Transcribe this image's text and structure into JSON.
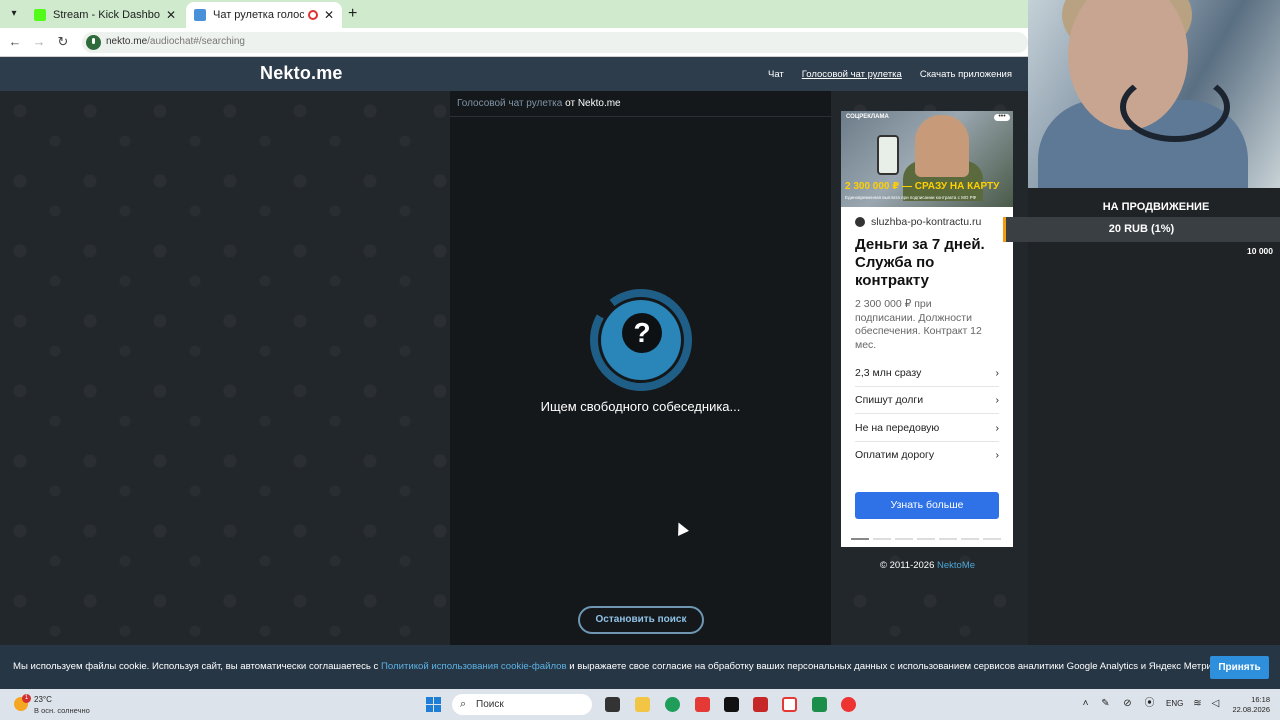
{
  "browser": {
    "tabs": [
      {
        "title": "Stream - Kick Dashboard",
        "favicon_color": "#53fc18"
      },
      {
        "title": "Чат рулетка голосовая — ",
        "favicon_color": "#4a90d9",
        "active": true
      }
    ],
    "new_tab_label": "+",
    "url_host": "nekto.me",
    "url_path": "/audiochat#/searching"
  },
  "site": {
    "logo": "Nekto.me",
    "nav": [
      "Чат",
      "Голосовой чат рулетка",
      "Скачать приложения"
    ],
    "chat_header_link": "Голосовой чат рулетка",
    "chat_header_suffix": "от Nekto.me",
    "search_icon_glyph": "?",
    "search_status": "Ищем свободного собеседника...",
    "stop_button": "Остановить поиск",
    "copyright_prefix": "© 2011-2026",
    "copyright_link": "NektoMe"
  },
  "ad": {
    "label": "СОЦРЕКЛАМА",
    "more_glyph": "•••",
    "banner": "2 300 000 ₽ — СРАЗУ НА КАРТУ",
    "banner_sub": "Единовременная выплата при подписании контракта с МО РФ",
    "domain": "sluzhba-po-kontractu.ru",
    "title": "Деньги за 7 дней. Служба по контракту",
    "description": "2 300 000 ₽ при подписании. Должности обеспечения. Контракт 12 мес.",
    "links": [
      "2,3 млн сразу",
      "Спишут долги",
      "Не на передовую",
      "Оплатим дорогу"
    ],
    "chevron": "›",
    "cta": "Узнать больше"
  },
  "stream_overlay": {
    "promo_title": "НА ПРОДВИЖЕНИЕ",
    "promo_amount": "20 RUB (1%)",
    "promo_goal": "10 000",
    "accent_color": "#f39c12"
  },
  "cookie": {
    "text_before": "Мы используем файлы cookie. Используя сайт, вы автоматически соглашаетесь с ",
    "link": "Политикой использования cookie-файлов",
    "text_after": " и выражаете свое согласие на обработку ваших персональных данных с использованием сервисов аналитики Google Analytics и Яндекс Метрика.",
    "accept": "Принять"
  },
  "taskbar": {
    "weather_badge": "1",
    "temperature": "23°C",
    "weather_desc": "В осн. солнечно",
    "search_label": "Поиск",
    "language": "ENG",
    "time": "16:18",
    "date": "22.08.2026"
  }
}
